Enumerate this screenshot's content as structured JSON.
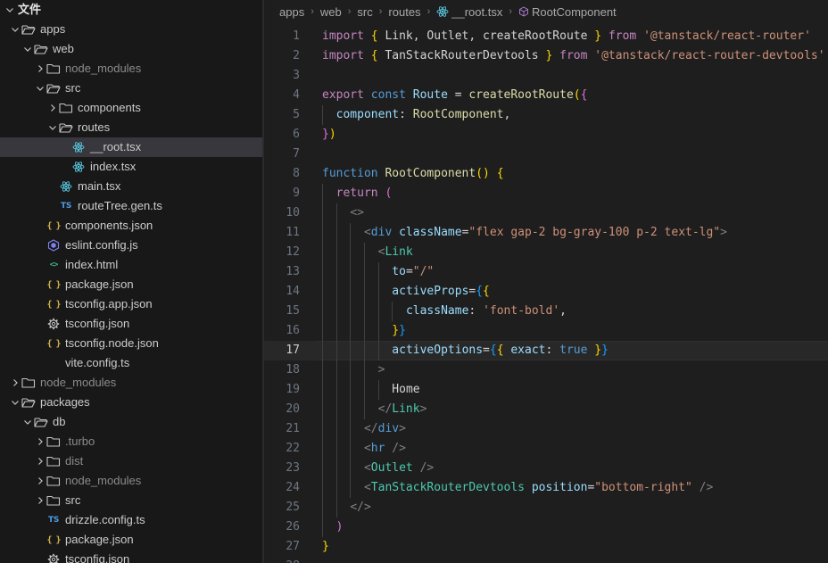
{
  "explorer": {
    "title": "文件",
    "items": [
      {
        "label": "apps",
        "type": "folder",
        "expanded": true,
        "depth": 0
      },
      {
        "label": "web",
        "type": "folder",
        "expanded": true,
        "depth": 1
      },
      {
        "label": "node_modules",
        "type": "folder",
        "expanded": false,
        "depth": 2,
        "dim": true
      },
      {
        "label": "src",
        "type": "folder",
        "expanded": true,
        "depth": 2
      },
      {
        "label": "components",
        "type": "folder",
        "expanded": false,
        "depth": 3
      },
      {
        "label": "routes",
        "type": "folder",
        "expanded": true,
        "depth": 3
      },
      {
        "label": "__root.tsx",
        "type": "react",
        "depth": 4,
        "selected": true
      },
      {
        "label": "index.tsx",
        "type": "react",
        "depth": 4
      },
      {
        "label": "main.tsx",
        "type": "react",
        "depth": 3
      },
      {
        "label": "routeTree.gen.ts",
        "type": "ts",
        "depth": 3
      },
      {
        "label": "components.json",
        "type": "json",
        "depth": 2
      },
      {
        "label": "eslint.config.js",
        "type": "eslint",
        "depth": 2
      },
      {
        "label": "index.html",
        "type": "html",
        "depth": 2
      },
      {
        "label": "package.json",
        "type": "json",
        "depth": 2
      },
      {
        "label": "tsconfig.app.json",
        "type": "json",
        "depth": 2
      },
      {
        "label": "tsconfig.json",
        "type": "gear",
        "depth": 2
      },
      {
        "label": "tsconfig.node.json",
        "type": "json",
        "depth": 2
      },
      {
        "label": "vite.config.ts",
        "type": "none",
        "depth": 2
      },
      {
        "label": "node_modules",
        "type": "folder",
        "expanded": false,
        "depth": 0,
        "dim": true
      },
      {
        "label": "packages",
        "type": "folder",
        "expanded": true,
        "depth": 0
      },
      {
        "label": "db",
        "type": "folder",
        "expanded": true,
        "depth": 1
      },
      {
        "label": ".turbo",
        "type": "folder",
        "expanded": false,
        "depth": 2,
        "dim": true
      },
      {
        "label": "dist",
        "type": "folder",
        "expanded": false,
        "depth": 2,
        "dim": true
      },
      {
        "label": "node_modules",
        "type": "folder",
        "expanded": false,
        "depth": 2,
        "dim": true
      },
      {
        "label": "src",
        "type": "folder",
        "expanded": false,
        "depth": 2
      },
      {
        "label": "drizzle.config.ts",
        "type": "ts",
        "depth": 2
      },
      {
        "label": "package.json",
        "type": "json",
        "depth": 2
      },
      {
        "label": "tsconfig.json",
        "type": "gear",
        "depth": 2
      }
    ]
  },
  "breadcrumb": {
    "parts": [
      "apps",
      "web",
      "src",
      "routes"
    ],
    "file": "__root.tsx",
    "symbol": "RootComponent"
  },
  "editor": {
    "current_line": 17,
    "lines": [
      {
        "n": "1",
        "indent": 0,
        "tokens": [
          [
            "kw",
            "import"
          ],
          [
            "plain",
            " "
          ],
          [
            "b1",
            "{"
          ],
          [
            "plain",
            " Link, Outlet, createRootRoute "
          ],
          [
            "b1",
            "}"
          ],
          [
            "plain",
            " "
          ],
          [
            "kw",
            "from"
          ],
          [
            "plain",
            " "
          ],
          [
            "str",
            "'@tanstack/react-router'"
          ]
        ]
      },
      {
        "n": "2",
        "indent": 0,
        "tokens": [
          [
            "kw",
            "import"
          ],
          [
            "plain",
            " "
          ],
          [
            "b1",
            "{"
          ],
          [
            "plain",
            " TanStackRouterDevtools "
          ],
          [
            "b1",
            "}"
          ],
          [
            "plain",
            " "
          ],
          [
            "kw",
            "from"
          ],
          [
            "plain",
            " "
          ],
          [
            "str",
            "'@tanstack/react-router-devtools'"
          ]
        ]
      },
      {
        "n": "3",
        "indent": 0,
        "tokens": []
      },
      {
        "n": "4",
        "indent": 0,
        "tokens": [
          [
            "kw",
            "export"
          ],
          [
            "plain",
            " "
          ],
          [
            "storage",
            "const"
          ],
          [
            "plain",
            " "
          ],
          [
            "var",
            "Route"
          ],
          [
            "plain",
            " = "
          ],
          [
            "fn",
            "createRootRoute"
          ],
          [
            "b1",
            "("
          ],
          [
            "b2",
            "{"
          ]
        ]
      },
      {
        "n": "5",
        "indent": 1,
        "tokens": [
          [
            "attr",
            "component"
          ],
          [
            "plain",
            ": "
          ],
          [
            "fn",
            "RootComponent"
          ],
          [
            "plain",
            ","
          ]
        ]
      },
      {
        "n": "6",
        "indent": 0,
        "tokens": [
          [
            "b2",
            "}"
          ],
          [
            "b1",
            ")"
          ]
        ]
      },
      {
        "n": "7",
        "indent": 0,
        "tokens": []
      },
      {
        "n": "8",
        "indent": 0,
        "tokens": [
          [
            "storage",
            "function"
          ],
          [
            "plain",
            " "
          ],
          [
            "fn",
            "RootComponent"
          ],
          [
            "b1",
            "()"
          ],
          [
            "plain",
            " "
          ],
          [
            "b1",
            "{"
          ]
        ]
      },
      {
        "n": "9",
        "indent": 1,
        "tokens": [
          [
            "kw",
            "return"
          ],
          [
            "plain",
            " "
          ],
          [
            "b2",
            "("
          ]
        ]
      },
      {
        "n": "10",
        "indent": 2,
        "tokens": [
          [
            "punct",
            "<>"
          ]
        ]
      },
      {
        "n": "11",
        "indent": 3,
        "tokens": [
          [
            "punct",
            "<"
          ],
          [
            "tag",
            "div"
          ],
          [
            "plain",
            " "
          ],
          [
            "attr",
            "className"
          ],
          [
            "plain",
            "="
          ],
          [
            "str",
            "\"flex gap-2 bg-gray-100 p-2 text-lg\""
          ],
          [
            "punct",
            ">"
          ]
        ]
      },
      {
        "n": "12",
        "indent": 4,
        "tokens": [
          [
            "punct",
            "<"
          ],
          [
            "comp",
            "Link"
          ]
        ]
      },
      {
        "n": "13",
        "indent": 5,
        "tokens": [
          [
            "attr",
            "to"
          ],
          [
            "plain",
            "="
          ],
          [
            "str",
            "\"/\""
          ]
        ]
      },
      {
        "n": "14",
        "indent": 5,
        "tokens": [
          [
            "attr",
            "activeProps"
          ],
          [
            "plain",
            "="
          ],
          [
            "b3",
            "{"
          ],
          [
            "b1",
            "{"
          ]
        ]
      },
      {
        "n": "15",
        "indent": 6,
        "tokens": [
          [
            "attr",
            "className"
          ],
          [
            "plain",
            ": "
          ],
          [
            "str",
            "'font-bold'"
          ],
          [
            "plain",
            ","
          ]
        ]
      },
      {
        "n": "16",
        "indent": 5,
        "tokens": [
          [
            "b1",
            "}"
          ],
          [
            "b3",
            "}"
          ]
        ]
      },
      {
        "n": "17",
        "indent": 5,
        "tokens": [
          [
            "attr",
            "activeOptions"
          ],
          [
            "plain",
            "="
          ],
          [
            "b3",
            "{"
          ],
          [
            "b1",
            "{"
          ],
          [
            "plain",
            " "
          ],
          [
            "attr",
            "exact"
          ],
          [
            "plain",
            ": "
          ],
          [
            "bool",
            "true"
          ],
          [
            "plain",
            " "
          ],
          [
            "b1",
            "}"
          ],
          [
            "b3",
            "}"
          ]
        ]
      },
      {
        "n": "18",
        "indent": 4,
        "tokens": [
          [
            "punct",
            ">"
          ]
        ]
      },
      {
        "n": "19",
        "indent": 5,
        "tokens": [
          [
            "plain",
            "Home"
          ]
        ]
      },
      {
        "n": "20",
        "indent": 4,
        "tokens": [
          [
            "punct",
            "</"
          ],
          [
            "comp",
            "Link"
          ],
          [
            "punct",
            ">"
          ]
        ]
      },
      {
        "n": "21",
        "indent": 3,
        "tokens": [
          [
            "punct",
            "</"
          ],
          [
            "tag",
            "div"
          ],
          [
            "punct",
            ">"
          ]
        ]
      },
      {
        "n": "22",
        "indent": 3,
        "tokens": [
          [
            "punct",
            "<"
          ],
          [
            "tag",
            "hr"
          ],
          [
            "plain",
            " "
          ],
          [
            "punct",
            "/>"
          ]
        ]
      },
      {
        "n": "23",
        "indent": 3,
        "tokens": [
          [
            "punct",
            "<"
          ],
          [
            "comp",
            "Outlet"
          ],
          [
            "plain",
            " "
          ],
          [
            "punct",
            "/>"
          ]
        ]
      },
      {
        "n": "24",
        "indent": 3,
        "tokens": [
          [
            "punct",
            "<"
          ],
          [
            "comp",
            "TanStackRouterDevtools"
          ],
          [
            "plain",
            " "
          ],
          [
            "attr",
            "position"
          ],
          [
            "plain",
            "="
          ],
          [
            "str",
            "\"bottom-right\""
          ],
          [
            "plain",
            " "
          ],
          [
            "punct",
            "/>"
          ]
        ]
      },
      {
        "n": "25",
        "indent": 2,
        "tokens": [
          [
            "punct",
            "</>"
          ]
        ]
      },
      {
        "n": "26",
        "indent": 1,
        "tokens": [
          [
            "b2",
            ")"
          ]
        ]
      },
      {
        "n": "27",
        "indent": 0,
        "tokens": [
          [
            "b1",
            "}"
          ]
        ]
      },
      {
        "n": "28",
        "indent": 0,
        "tokens": []
      }
    ]
  },
  "colors": {
    "folder": "#c5c5c5",
    "react": "#58c4dc",
    "ts": "#4d9be6",
    "json": "#d4b44b",
    "eslint": "#8080f2",
    "html": "#3bb08f",
    "gear": "#c5c5c5"
  }
}
